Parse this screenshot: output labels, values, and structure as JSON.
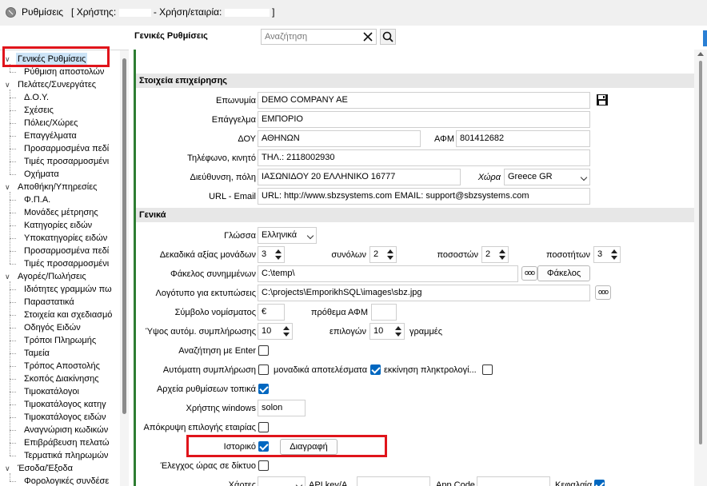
{
  "window": {
    "title_prefix": "Ρυθμίσεις",
    "title_user_label": "[ Χρήστης:",
    "title_company_label": "- Χρήση/εταιρία:",
    "title_suffix": "]"
  },
  "header": {
    "settings_label": "Γενικές Ρυθμίσεις",
    "search_placeholder": "Αναζήτηση"
  },
  "tree": {
    "items": [
      {
        "label": "Γενικές Ρυθμίσεις",
        "level": 0,
        "expanded": true,
        "selected": true
      },
      {
        "label": "Ρύθμιση αποστολών",
        "level": 1
      },
      {
        "label": "Πελάτες/Συνεργάτες",
        "level": 0,
        "expanded": true
      },
      {
        "label": "Δ.Ο.Υ.",
        "level": 1
      },
      {
        "label": "Σχέσεις",
        "level": 1
      },
      {
        "label": "Πόλεις/Χώρες",
        "level": 1
      },
      {
        "label": "Επαγγέλματα",
        "level": 1
      },
      {
        "label": "Προσαρμοσμένα πεδί",
        "level": 1
      },
      {
        "label": "Τιμές προσαρμοσμένι",
        "level": 1
      },
      {
        "label": "Οχήματα",
        "level": 1
      },
      {
        "label": "Αποθήκη/Υπηρεσίες",
        "level": 0,
        "expanded": true
      },
      {
        "label": "Φ.Π.Α.",
        "level": 1
      },
      {
        "label": "Μονάδες μέτρησης",
        "level": 1
      },
      {
        "label": "Κατηγορίες ειδών",
        "level": 1
      },
      {
        "label": "Υποκατηγορίες ειδών",
        "level": 1
      },
      {
        "label": "Προσαρμοσμένα πεδί",
        "level": 1
      },
      {
        "label": "Τιμές προσαρμοσμένι",
        "level": 1
      },
      {
        "label": "Αγορές/Πωλήσεις",
        "level": 0,
        "expanded": true
      },
      {
        "label": "Ιδιότητες γραμμών πω",
        "level": 1
      },
      {
        "label": "Παραστατικά",
        "level": 1
      },
      {
        "label": "Στοιχεία και σχεδιασμό",
        "level": 1
      },
      {
        "label": "Οδηγός Ειδών",
        "level": 1
      },
      {
        "label": "Τρόποι Πληρωμής",
        "level": 1
      },
      {
        "label": "Ταμεία",
        "level": 1
      },
      {
        "label": "Τρόπος Αποστολής",
        "level": 1
      },
      {
        "label": "Σκοπός Διακίνησης",
        "level": 1
      },
      {
        "label": "Τιμοκατάλογοι",
        "level": 1
      },
      {
        "label": "Τιμοκατάλογος κατηγ",
        "level": 1
      },
      {
        "label": "Τιμοκατάλογος ειδών",
        "level": 1
      },
      {
        "label": "Αναγνώριση κωδικών",
        "level": 1
      },
      {
        "label": "Επιβράβευση πελατώ",
        "level": 1
      },
      {
        "label": "Τερματικά πληρωμών",
        "level": 1
      },
      {
        "label": "Έσοδα/Έξοδα",
        "level": 0,
        "expanded": true
      },
      {
        "label": "Φορολογικές συνδέσε",
        "level": 1
      }
    ]
  },
  "business": {
    "section_title": "Στοιχεία επιχείρησης",
    "name_label": "Επωνυμία",
    "name_value": "DEMO COMPANY AE",
    "profession_label": "Επάγγελμα",
    "profession_value": "ΕΜΠΟΡΙΟ",
    "doy_label": "ΔΟΥ",
    "doy_value": "ΑΘΗΝΩΝ",
    "afm_label": "ΑΦΜ",
    "afm_value": "801412682",
    "phone_label": "Τηλέφωνο, κινητό",
    "phone_value": "ΤΗΛ.: 2118002930",
    "address_label": "Διεύθυνση, πόλη",
    "address_value": "ΙΑΣΩΝΙΔΟΥ 20 ΕΛΛΗΝΙΚΟ 16777",
    "country_label": "Χώρα",
    "country_value": "Greece GR",
    "url_label": "URL - Email",
    "url_value": "URL: http://www.sbzsystems.com EMAIL: support@sbzsystems.com"
  },
  "general": {
    "section_title": "Γενικά",
    "language_label": "Γλώσσα",
    "language_value": "Ελληνικά",
    "decimals_label": "Δεκαδικά αξίας μονάδων",
    "decimals_value": "3",
    "totals_label": "συνόλων",
    "totals_value": "2",
    "percent_label": "ποσοστών",
    "percent_value": "2",
    "qty_label": "ποσοτήτων",
    "qty_value": "3",
    "attach_label": "Φάκελος συνημμένων",
    "attach_value": "C:\\temp\\",
    "dots_label": "ooo",
    "folder_button": "Φάκελος",
    "logo_label": "Λογότυπο για εκτυπώσεις",
    "logo_value": "C:\\projects\\EmporikhSQL\\images\\sbz.jpg",
    "currency_label": "Σύμβολο νομίσματος",
    "currency_value": "€",
    "afm_prefix_label": "πρόθεμα ΑΦΜ",
    "afm_prefix_value": "",
    "autofill_height_label": "Ύψος αυτόμ. συμπλήρωσης",
    "autofill_height_value": "10",
    "options_label": "επιλογών",
    "options_value": "10",
    "lines_label": "γραμμές",
    "search_enter_label": "Αναζήτηση με Enter",
    "autocomplete_label": "Αυτόματη συμπλήρωση",
    "unique_results_label": "μοναδικά αποτελέσματα",
    "keyboard_start_label": "εκκίνηση πληκτρολογί...",
    "local_settings_label": "Αρχεία ρυθμίσεων τοπικά",
    "windows_user_label": "Χρήστης windows",
    "windows_user_value": "solon",
    "hide_company_label": "Απόκρυψη επιλογής εταιρίας",
    "history_label": "Ιστορικό",
    "delete_button": "Διαγραφή",
    "net_time_label": "Έλεγχος ώρας σε δίκτυο",
    "bottom_label_1": "Χάρτες",
    "bottom_label_2": "API key/A",
    "bottom_label_3": "App Code",
    "bottom_label_4": "Κεφαλαία"
  },
  "colors": {
    "accent": "#0067c0",
    "highlight": "#e0141b",
    "panel_border": "#2e7d32"
  }
}
